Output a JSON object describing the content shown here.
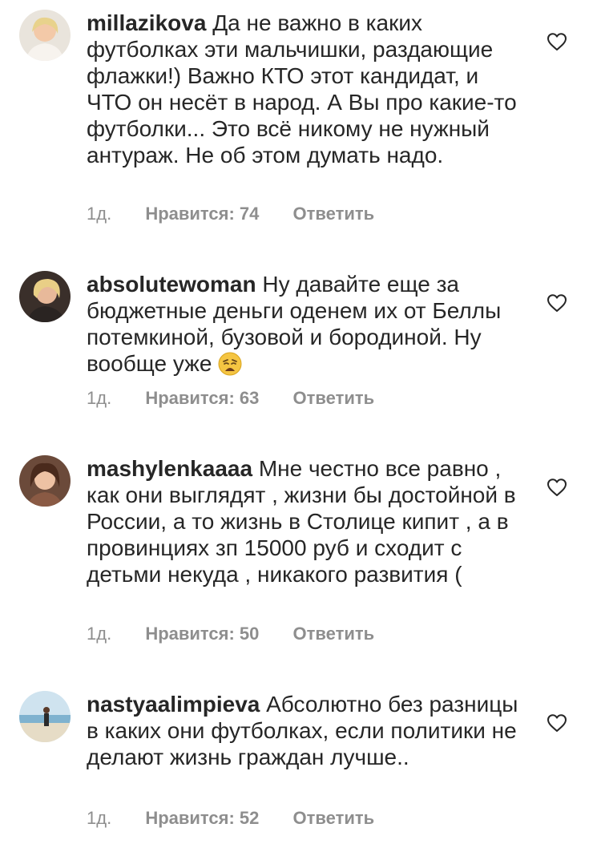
{
  "comments": [
    {
      "username": "millazikova",
      "text": "Да не важно в каких футболках эти мальчишки, раздающие флажки!) Важно КТО этот кандидат, и ЧТО он несёт в народ. А Вы про какие-то футболки... Это всё никому не нужный антураж. Не об этом думать надо.",
      "time": "1д.",
      "likes": "Нравится: 74",
      "reply": "Ответить"
    },
    {
      "username": "absolutewoman",
      "text": "Ну давайте еще за бюджетные деньги оденем их от Беллы потемкиной, бузовой и бородиной. Ну вообще уже",
      "emoji": "weary-face-emoji",
      "time": "1д.",
      "likes": "Нравится: 63",
      "reply": "Ответить"
    },
    {
      "username": "mashylenkaaaa",
      "text": "Мне честно все равно , как они выглядят , жизни бы достойной в России, а то жизнь в Столице кипит , а в провинциях зп 15000 руб и сходит с детьми некуда , никакого развития (",
      "time": "1д.",
      "likes": "Нравится: 50",
      "reply": "Ответить"
    },
    {
      "username": "nastyaalimpieva",
      "text": "Абсолютно без разницы в каких они футболках, если политики не делают жизнь граждан лучше..",
      "time": "1д.",
      "likes": "Нравится: 52",
      "reply": "Ответить"
    }
  ],
  "icons": {
    "like": "heart-outline-icon"
  }
}
